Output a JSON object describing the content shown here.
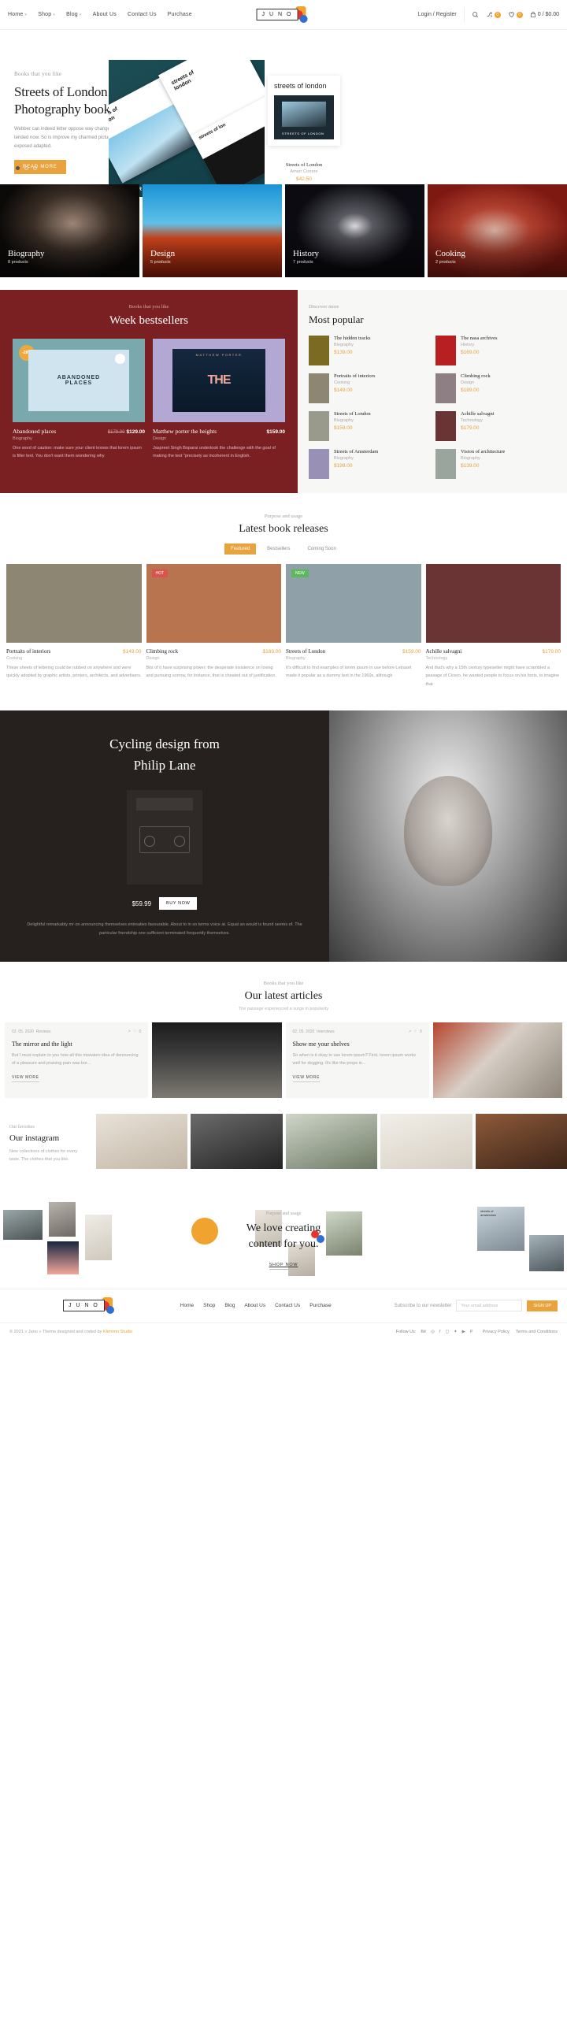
{
  "header": {
    "nav": [
      {
        "label": "Home",
        "caret": true
      },
      {
        "label": "Shop",
        "caret": true
      },
      {
        "label": "Blog",
        "caret": true
      },
      {
        "label": "About Us",
        "caret": false
      },
      {
        "label": "Contact Us",
        "caret": false
      },
      {
        "label": "Purchase",
        "caret": false
      }
    ],
    "logo_text": "J U N O",
    "login": "Login / Register",
    "compare_count": "0",
    "wishlist_count": "0",
    "cart_summary": "0 / $0.00"
  },
  "hero": {
    "eyebrow": "Books that you like",
    "title": "Streets of London Photography book.",
    "paragraph": "Webber can indeed letter oppose way change tended now. So is improve my charmed picture exposed adapted.",
    "button": "READ MORE",
    "book_cover_text": "streets of london",
    "card": {
      "title": "streets of london",
      "name": "Streets of London",
      "author": "Amarr Correre",
      "price": "$42.50"
    }
  },
  "categories": [
    {
      "name": "Biography",
      "count": "8 products",
      "color": "#171513"
    },
    {
      "name": "Design",
      "count": "5 products",
      "color": "#1a73b8"
    },
    {
      "name": "History",
      "count": "7 products",
      "color": "#0c0c12"
    },
    {
      "name": "Cooking",
      "count": "2 products",
      "color": "#8f1f1a"
    }
  ],
  "bestsellers": {
    "eyebrow": "Books that you like",
    "title": "Week bestsellers",
    "items": [
      {
        "badge": "-28%",
        "name": "Abandoned places",
        "price": "$129.00",
        "old_price": "$179.00",
        "category": "Biography",
        "description": "One word of caution: make sure your client knows that lorem ipsum is filler text. You don't want them wondering why",
        "cover_bg": "#79a8ad",
        "cover_title": "ABANDONED PLACES"
      },
      {
        "badge": "",
        "name": "Matthew porter the heights",
        "price": "$159.00",
        "old_price": "",
        "category": "Design",
        "description": "Jaspreet Singh Boparai undertook the challenge with the goal of making the text \"precisely as incoherent in English.",
        "cover_bg": "#b3a8d4",
        "cover_title": "THE HEIGHTS"
      }
    ]
  },
  "most_popular": {
    "eyebrow": "Discover more",
    "title": "Most popular",
    "items": [
      {
        "name": "The hidden tracks",
        "category": "Biography",
        "price": "$139.00",
        "thumb": "#7a6a22"
      },
      {
        "name": "The nasa archives",
        "category": "History",
        "price": "$169.00",
        "thumb": "#b81f20"
      },
      {
        "name": "Portraits of interiors",
        "category": "Cooking",
        "price": "$149.00",
        "thumb": "#8d8672"
      },
      {
        "name": "Climbing rock",
        "category": "Design",
        "price": "$189.00",
        "thumb": "#8d7f84"
      },
      {
        "name": "Streets of London",
        "category": "Biography",
        "price": "$159.00",
        "thumb": "#9a9a8c"
      },
      {
        "name": "Achille salvagni",
        "category": "Technology",
        "price": "$179.00",
        "thumb": "#6b3434"
      },
      {
        "name": "Streets of Amsterdam",
        "category": "Biography",
        "price": "$199.00",
        "thumb": "#9890b5"
      },
      {
        "name": "Vision of architecture",
        "category": "Biography",
        "price": "$139.00",
        "thumb": "#9aa59d"
      }
    ]
  },
  "latest_releases": {
    "eyebrow": "Purpose and usage",
    "title": "Latest book releases",
    "tabs": [
      {
        "label": "Featured",
        "active": true
      },
      {
        "label": "Bestsellers",
        "active": false
      },
      {
        "label": "Coming Soon",
        "active": false
      }
    ],
    "items": [
      {
        "tag": "",
        "tag_type": "",
        "name": "Portraits of interiors",
        "price": "$149.00",
        "category": "Cooking",
        "description": "These sheets of lettering could be rubbed on anywhere and were quickly adopted by graphic artists, printers, architects, and advertisers.",
        "img_bg": "#8d8672"
      },
      {
        "tag": "HOT",
        "tag_type": "hot",
        "name": "Climbing rock",
        "price": "$189.00",
        "category": "Design",
        "description": "Bits of it have surprising power: the desperate insistence on loving and pursuing sorrow, for instance, that is cheated out of justification.",
        "img_bg": "#b8744e"
      },
      {
        "tag": "NEW",
        "tag_type": "new",
        "name": "Streets of London",
        "price": "$159.00",
        "category": "Biography",
        "description": "It's difficult to find examples of lorem ipsum in use before Letraset made it popular as a dummy text in the 1960s, although",
        "img_bg": "#8fa0a8"
      },
      {
        "tag": "",
        "tag_type": "",
        "name": "Achille salvagni",
        "price": "$179.00",
        "category": "Technology",
        "description": "And that's why a 15th century typesetter might have scrambled a passage of Cicero, he wanted people to focus on his fonts, to imagine that",
        "img_bg": "#6b3434"
      }
    ]
  },
  "promo": {
    "title_line1": "Cycling design from",
    "title_line2": "Philip Lane",
    "price": "$59.99",
    "button": "BUY NOW",
    "paragraph": "Delightful remarkably mr on announcing themselves entreaties favourable. About to in so terms voice at. Equal an would is found seems of. The particular friendship one sufficient terminated frequently themselves."
  },
  "articles": {
    "eyebrow": "Books that you like",
    "title": "Our latest articles",
    "subtitle": "The passage experienced a surge in popularity",
    "items": [
      {
        "date": "02. 05. 2020",
        "category": "Reviews",
        "likes": "0",
        "title": "The mirror and the light",
        "text": "But I must explain to you how all this mistaken idea of denouncing of a pleasure and praising pain was bor...",
        "more": "VIEW MORE"
      },
      {
        "date": "02. 05. 2020",
        "category": "Interviews",
        "likes": "0",
        "title": "Show me your shelves",
        "text": "So when is it okay to use lorem ipsum? First, lorem ipsum works well for dogging. It's like the props in...",
        "more": "VIEW MORE"
      }
    ]
  },
  "instagram": {
    "eyebrow": "Our favorites",
    "title": "Our instagram",
    "paragraph": "New collections of clothes for every taste. The clothes that you like."
  },
  "cta": {
    "eyebrow": "Purpose and usage",
    "title_line1": "We love creating",
    "title_line2": "content for you.",
    "button": "SHOP NOW"
  },
  "footer": {
    "logo_text": "J U N O",
    "nav": [
      "Home",
      "Shop",
      "Blog",
      "About Us",
      "Contact Us",
      "Purchase"
    ],
    "newsletter_label": "Subscribe to our newsletter",
    "newsletter_placeholder": "Your email address",
    "newsletter_button": "SIGN UP",
    "copyright": "© 2021 « Juno » Theme designed and coded by",
    "author": "Klemmn Studio",
    "follow_label": "Follow Us:",
    "legal": [
      "Privacy Policy",
      "Terms and Conditions"
    ]
  },
  "colors": {
    "accent": "#e8a33d",
    "bestseller_bg": "#7a1f22",
    "promo_bg": "#26211f"
  }
}
